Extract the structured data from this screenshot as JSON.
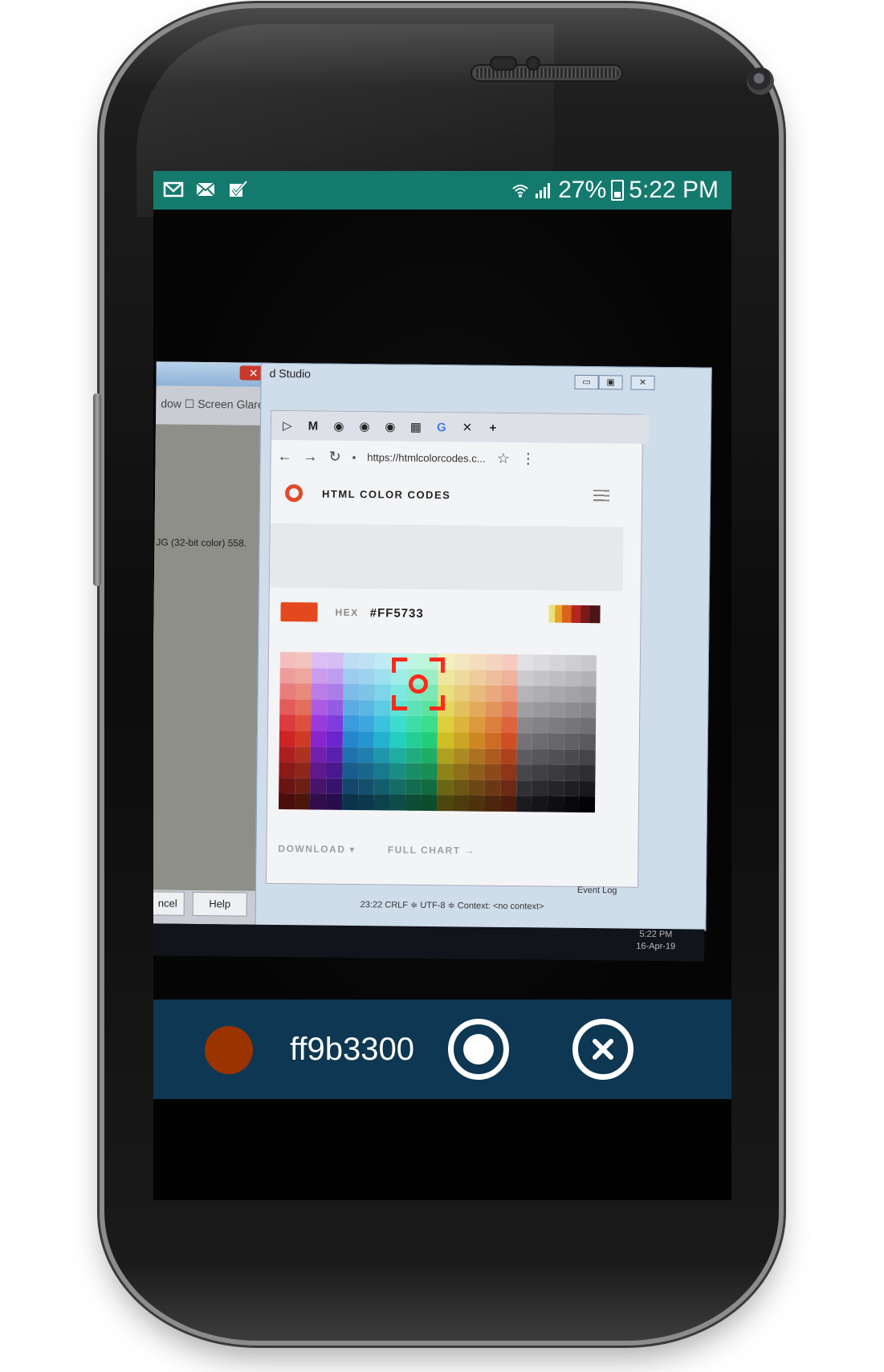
{
  "statusbar": {
    "battery": "27%",
    "time": "5:22 PM",
    "left_icons": [
      "gmail-icon",
      "mail-icon",
      "task-check-icon"
    ],
    "right_icons": [
      "wifi-icon",
      "signal-icon",
      "battery-charging-icon"
    ]
  },
  "viewfinder": {
    "left_window": {
      "glare_label": "dow  ☐ Screen Glare",
      "panel_text": "JG (32-bit color) 558.",
      "cancel_label": "ncel",
      "help_label": "Help"
    },
    "ide": {
      "title": "d Studio",
      "status_line": "23:22   CRLF ≑   UTF-8 ≑   Context: <no context>",
      "event_log": "Event Log"
    },
    "browser": {
      "url": "https://htmlcolorcodes.c...",
      "site_title": "HTML COLOR CODES",
      "hex_label": "HEX",
      "hex_value": "#FF5733",
      "download_label": "DOWNLOAD ▾",
      "full_chart_label": "FULL CHART →"
    },
    "taskbar": {
      "time": "5:22 PM",
      "date": "16-Apr-19"
    }
  },
  "control_bar": {
    "picked_color": "#9b3300",
    "hex_code": "ff9b3300"
  },
  "colors": {
    "statusbar_bg": "#157a6e",
    "control_bar_bg": "#0d3752",
    "reticle": "#ff2a1a"
  }
}
